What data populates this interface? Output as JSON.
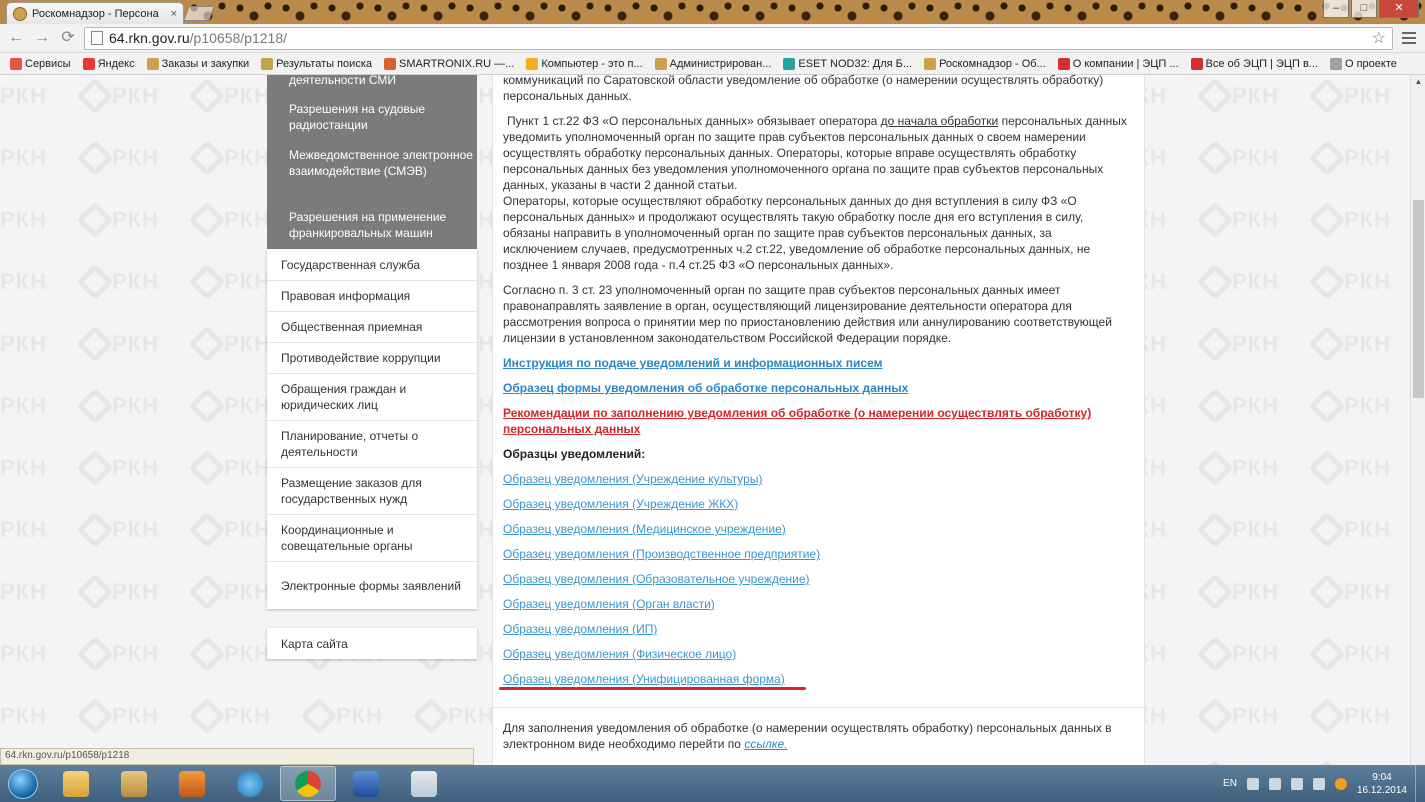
{
  "browser": {
    "tab_title": "Роскомнадзор - Персона",
    "tab_close": "×",
    "win_minimize": "–",
    "win_maximize": "□",
    "win_close": "✕",
    "back": "←",
    "forward": "→",
    "reload": "⟳",
    "url_host": "64.rkn.gov.ru",
    "url_path": "/p10658/p1218/",
    "star": "☆"
  },
  "bookmarks": [
    {
      "label": "Сервисы",
      "color": "#e5554a"
    },
    {
      "label": "Яндекс",
      "color": "#e53935"
    },
    {
      "label": "Заказы и закупки",
      "color": "#c9a34a"
    },
    {
      "label": "Результаты поиска",
      "color": "#c9a34a"
    },
    {
      "label": "SMARTRONIX.RU —...",
      "color": "#d3642c"
    },
    {
      "label": "Компьютер - это п...",
      "color": "#f2b01e"
    },
    {
      "label": "Администрирован...",
      "color": "#c9a34a"
    },
    {
      "label": "ESET NOD32: Для Б...",
      "color": "#2aa199"
    },
    {
      "label": "Роскомнадзор - Об...",
      "color": "#c9a34a"
    },
    {
      "label": "О компании | ЭЦП ...",
      "color": "#d32f2f"
    },
    {
      "label": "Все об ЭЦП | ЭЦП в...",
      "color": "#d32f2f"
    },
    {
      "label": "О проекте",
      "color": "#9e9e9e"
    }
  ],
  "sidebar_dark": [
    "деятельности СМИ",
    "Разрешения на судовые радиостанции",
    "Межведомственное электронное взаимодействие (СМЭВ)",
    "Разрешения на применение франкировальных машин"
  ],
  "sidebar_items": [
    "Государственная служба",
    "Правовая информация",
    "Общественная приемная",
    "Противодействие коррупции",
    "Обращения граждан и юридических лиц",
    "Планирование, отчеты о деятельности",
    "Размещение заказов для государственных нужд",
    "Координационные и совещательные органы",
    "Электронные формы заявлений"
  ],
  "sitemap": "Карта сайта",
  "watermark": "РКН",
  "content": {
    "p0": "коммуникаций по Саратовской области уведомление об обработке (о намерении осуществлять обработку) персональных данных.",
    "p1_a": "Пункт 1 ст.22 ФЗ «О персональных данных» обязывает оператора ",
    "p1_u": "до начала обработки",
    "p1_b": " персональных данных уведомить уполномоченный орган по защите прав субъектов персональных данных о своем намерении осуществлять обработку персональных данных. Операторы, которые вправе осуществлять обработку персональных данных без уведомления уполномоченного органа по защите прав субъектов персональных данных, указаны в части 2 данной статьи.",
    "p2": "Операторы, которые осуществляют обработку персональных данных до дня вступления в силу ФЗ «О персональных данных» и продолжают осуществлять такую обработку после дня его вступления в силу, обязаны направить в уполномоченный орган по защите прав субъектов персональных данных, за исключением случаев, предусмотренных ч.2 ст.22, уведомление об обработке персональных данных, не позднее 1 января 2008 года - п.4 ст.25 ФЗ «О персональных данных».",
    "p3": "Согласно п. 3 ст. 23 уполномоченный орган по защите прав субъектов персональных данных имеет правонаправлять заявление в орган, осуществляющий лицензирование деятельности оператора для рассмотрения вопроса о принятии мер по приостановлению действия или аннулированию соответствующей лицензии в установленном законодательством Российской Федерации порядке.",
    "link_instructions": "Инструкция по подаче уведомлений и информационных писем",
    "link_form": "Образец формы уведомления об обработке персональных данных",
    "link_recommendations": "Рекомендации по заполнению уведомления об обработке (о намерении осуществлять обработку) персональных данных",
    "samples_title": "Образцы уведомлений:",
    "samples": [
      "Образец уведомления (Учреждение культуры)",
      "Образец уведомления (Учреждение ЖКХ)",
      "Образец уведомления (Медицинское учреждение)",
      "Образец уведомления (Производственное предприятие)",
      "Образец уведомления (Образовательное учреждение)",
      "Образец уведомления (Орган власти)",
      "Образец уведомления (ИП)",
      "Образец уведомления (Физическое лицо)",
      "Образец уведомления (Унифицированная форма)"
    ],
    "p4_a": "Для заполнения уведомления об обработке (о намерении осуществлять обработку) персональных данных в электронном виде необходимо перейти по ",
    "p4_link": "ссылке."
  },
  "statusbar": "64.rkn.gov.ru/p10658/p1218",
  "taskbar": {
    "lang": "EN",
    "time": "9:04",
    "date": "16.12.2014"
  }
}
